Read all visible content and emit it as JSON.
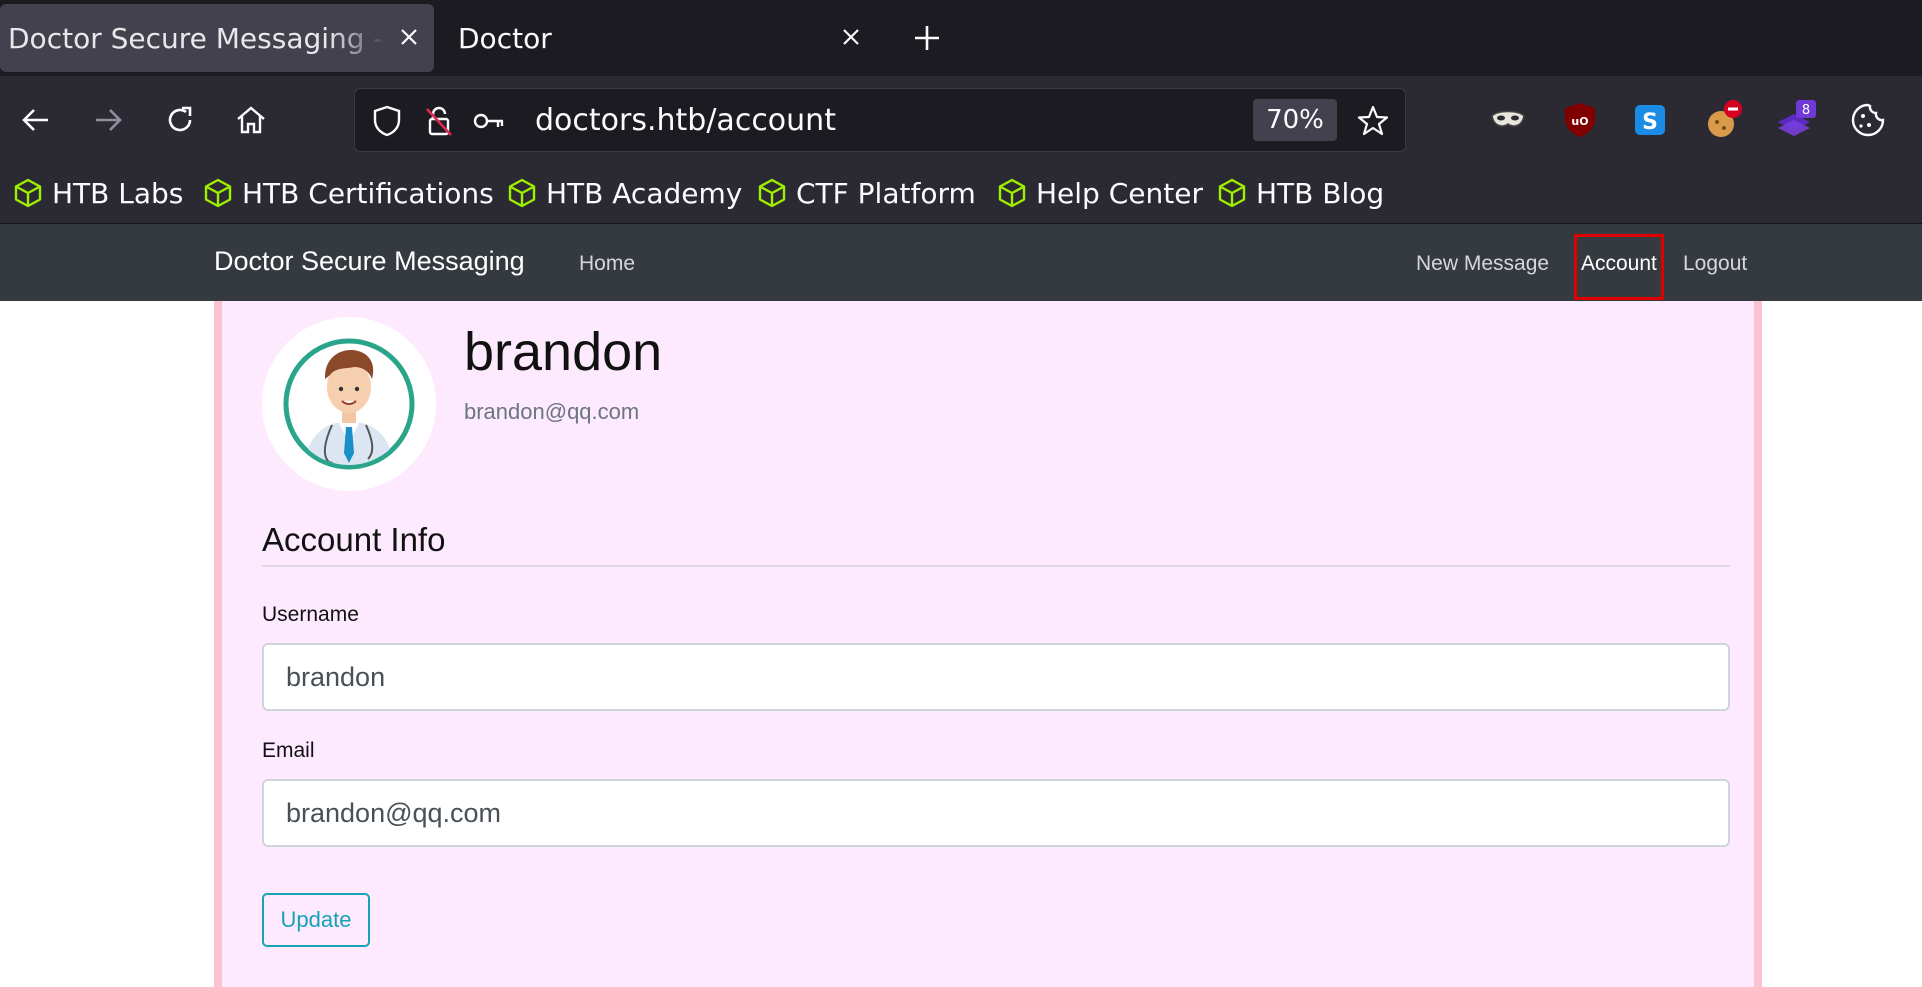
{
  "browser": {
    "tabs": [
      {
        "label": "Doctor Secure Messaging - Account",
        "active": true
      },
      {
        "label": "Doctor",
        "active": false
      }
    ],
    "url": "doctors.htb/account",
    "zoom": "70%",
    "bookmarks": [
      "HTB Labs",
      "HTB Certifications",
      "HTB Academy",
      "CTF Platform",
      "Help Center",
      "HTB Blog"
    ],
    "extensions": {
      "badge_count": "8"
    },
    "icons": [
      "back-icon",
      "forward-icon",
      "reload-icon",
      "home-icon",
      "shield-icon",
      "lock-slash-icon",
      "key-icon",
      "star-icon",
      "plus-icon",
      "close-icon"
    ]
  },
  "site": {
    "brand": "Doctor Secure Messaging",
    "nav": {
      "home": "Home",
      "new_message": "New Message",
      "account": "Account",
      "logout": "Logout"
    }
  },
  "profile": {
    "name": "brandon",
    "email": "brandon@qq.com"
  },
  "form": {
    "section_title": "Account Info",
    "username_label": "Username",
    "username_value": "brandon",
    "email_label": "Email",
    "email_value": "brandon@qq.com",
    "submit_label": "Update"
  },
  "colors": {
    "navbar": "#343a40",
    "card_bg": "#feeafe",
    "card_border": "#fbc2d3",
    "accent": "#17a2b8",
    "highlight": "#e00000"
  }
}
